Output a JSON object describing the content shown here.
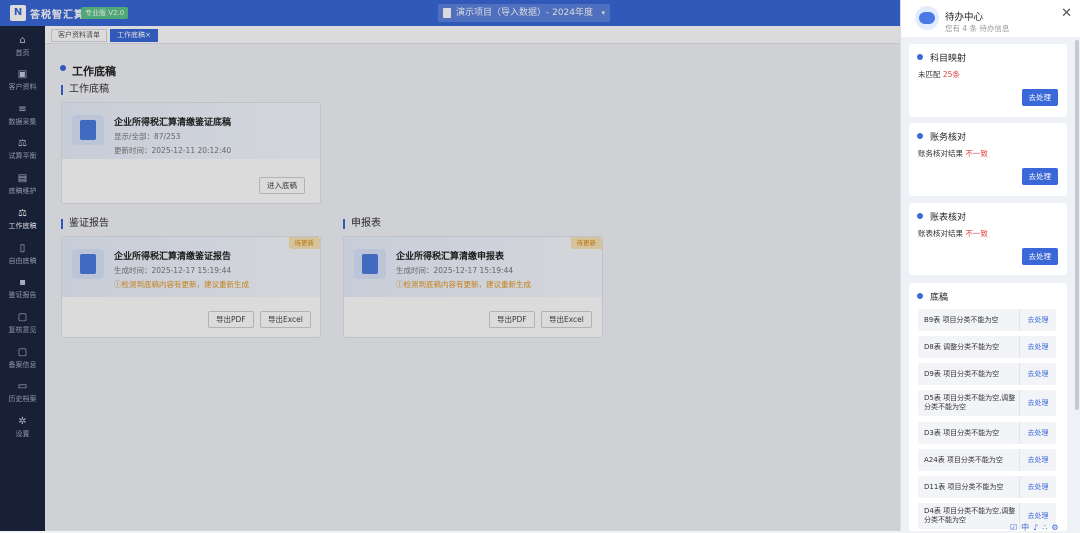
{
  "app": {
    "name": "答税智汇算",
    "version": "专业版 V2.0",
    "project": "演示项目（导入数据）- 2024年度",
    "arrow": "▾",
    "logo": "N"
  },
  "sidebar": [
    {
      "label": "首页",
      "icon": "⌂"
    },
    {
      "label": "客户资料",
      "icon": "▣"
    },
    {
      "label": "数据采集",
      "icon": "≡"
    },
    {
      "label": "试算平衡",
      "icon": "⚖"
    },
    {
      "label": "底稿维护",
      "icon": "▤"
    },
    {
      "label": "工作底稿",
      "icon": "⚖"
    },
    {
      "label": "自由底稿",
      "icon": "▯"
    },
    {
      "label": "鉴证报告",
      "icon": "▪"
    },
    {
      "label": "复核意见",
      "icon": "▢"
    },
    {
      "label": "备案信息",
      "icon": "▢"
    },
    {
      "label": "历史档案",
      "icon": "▭"
    },
    {
      "label": "设置",
      "icon": "✲"
    }
  ],
  "tabs": [
    {
      "label": "客户资料清单"
    },
    {
      "label": "工作底稿"
    }
  ],
  "tab_close": "×",
  "main": {
    "title": "工作底稿",
    "section1": "工作底稿",
    "card1": {
      "title": "企业所得税汇算清缴鉴证底稿",
      "line1": "显示/全部：87/253",
      "line2": "更新时间：2025-12-11 20:12:40",
      "btn": "进入底稿"
    },
    "section2": "鉴证报告",
    "card2": {
      "title": "企业所得税汇算清缴鉴证报告",
      "line1": "生成时间：2025-12-17 15:19:44",
      "warn": "ⓘ检测到底稿内容有更新，建议重新生成",
      "badge": "待更新",
      "btn1": "导出PDF",
      "btn2": "导出Excel"
    },
    "section3": "申报表",
    "card3": {
      "title": "企业所得税汇算清缴申报表",
      "line1": "生成时间：2025-12-17 15:19:44",
      "warn": "ⓘ检测到底稿内容有更新，建议重新生成",
      "badge": "待更新",
      "btn1": "导出PDF",
      "btn2": "导出Excel"
    }
  },
  "panel": {
    "title": "待办中心",
    "subtitle": "您有 4 条 待办信息",
    "close": "✕",
    "sections": [
      {
        "title": "科目映射",
        "desc_prefix": "未匹配 ",
        "desc_value": "25条",
        "btn": "去处理"
      },
      {
        "title": "账务核对",
        "desc_prefix": "账务核对结果 ",
        "desc_value": "不一致",
        "btn": "去处理"
      },
      {
        "title": "账表核对",
        "desc_prefix": "账表核对结果 ",
        "desc_value": "不一致",
        "btn": "去处理"
      }
    ],
    "draft_title": "底稿",
    "drafts": [
      {
        "text": "B9表 项目分类不能为空",
        "action": "去处理"
      },
      {
        "text": "D8表 调整分类不能为空",
        "action": "去处理"
      },
      {
        "text": "D9表 项目分类不能为空",
        "action": "去处理"
      },
      {
        "text": "D5表 项目分类不能为空,调整分类不能为空",
        "action": "去处理"
      },
      {
        "text": "D3表 项目分类不能为空",
        "action": "去处理"
      },
      {
        "text": "A24表 项目分类不能为空",
        "action": "去处理"
      },
      {
        "text": "D11表 项目分类不能为空",
        "action": "去处理"
      },
      {
        "text": "D4表 项目分类不能为空,调整分类不能为空",
        "action": "去处理"
      }
    ]
  },
  "toolbar_icons": "☑中♪∴⚙"
}
